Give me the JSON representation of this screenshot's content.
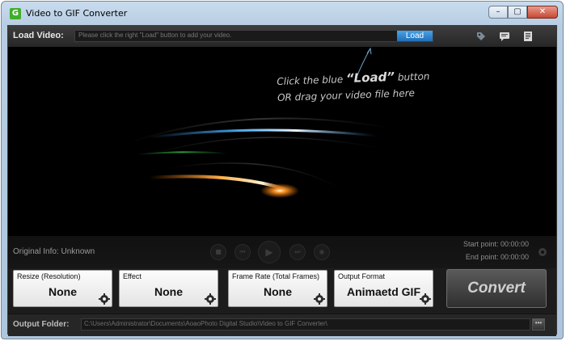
{
  "window": {
    "title": "Video to GIF Converter",
    "app_icon_letter": "G",
    "minimize": "–",
    "maximize": "▢",
    "close": "✕"
  },
  "load": {
    "label": "Load Video:",
    "placeholder": "Please click the right \"Load\" button to add your video.",
    "button": "Load",
    "icons": [
      "tag-icon",
      "chat-icon",
      "document-icon"
    ]
  },
  "video_hint": {
    "line1_prefix": "Click the blue ",
    "line1_highlight": "“Load”",
    "line1_suffix": " button",
    "line2": "OR drag your video file here"
  },
  "player": {
    "original_info": "Original Info: Unknown",
    "start_point": "Start point: 00:00:00",
    "end_point": "End point: 00:00:00",
    "buttons": [
      "stop",
      "previous",
      "play",
      "next",
      "snapshot"
    ]
  },
  "options": [
    {
      "label": "Resize (Resolution)",
      "value": "None"
    },
    {
      "label": "Effect",
      "value": "None"
    },
    {
      "label": "Frame Rate (Total Frames)",
      "value": "None"
    },
    {
      "label": "Output Format",
      "value": "Animaetd GIF"
    }
  ],
  "convert_label": "Convert",
  "output": {
    "label": "Output Folder:",
    "path": "C:\\Users\\Administrator\\Documents\\AoaoPhoto Digital Studio\\Video to GIF Converter\\",
    "browse": "•••"
  },
  "colors": {
    "accent_blue": "#2a86d1",
    "dark_bg": "#0b0b0c",
    "frame": "#b7cde3"
  }
}
